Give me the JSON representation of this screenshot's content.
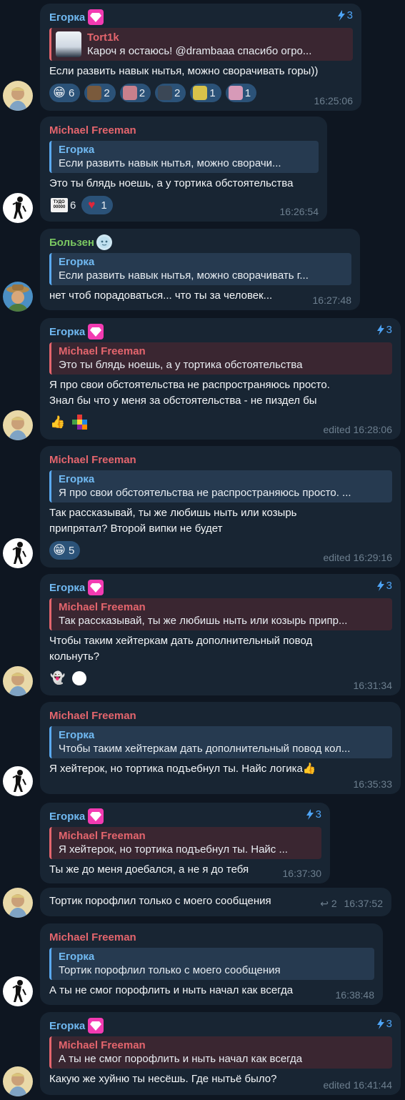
{
  "messages": [
    {
      "sender": "Егорка",
      "boost": "3",
      "reply": {
        "name": "Tort1k",
        "text": "Кароч я остаюсь! @drambaaa спасибо огро..."
      },
      "text": "Если развить навык нытья, можно сворачивать горы))",
      "reactions": [
        {
          "icon": "grinning-emoji",
          "count": "6"
        },
        {
          "icon": "user-avatar-1",
          "count": "2"
        },
        {
          "icon": "user-avatar-2",
          "count": "2"
        },
        {
          "icon": "user-avatar-3",
          "count": "2"
        },
        {
          "icon": "user-avatar-4",
          "count": "1"
        },
        {
          "icon": "user-avatar-5",
          "count": "1"
        }
      ],
      "time": "16:25:06"
    },
    {
      "sender": "Michael Freeman",
      "reply": {
        "name": "Егорка",
        "text": "Если развить навык нытья, можно сворачи..."
      },
      "text": "Это ты блядь ноешь, а у тортика обстоятельства",
      "reactions": [
        {
          "icon": "tudo-sign-emoji",
          "label": "ТУДО 00000",
          "count": "6"
        },
        {
          "icon": "heart-emoji",
          "count": "1"
        }
      ],
      "time": "16:26:54"
    },
    {
      "sender": "Бользен",
      "reply": {
        "name": "Егорка",
        "text": "Если развить навык нытья, можно сворачивать г..."
      },
      "text": "нет чтоб порадоваться... что ты за человек...",
      "time": "16:27:48"
    },
    {
      "sender": "Егорка",
      "boost": "3",
      "reply": {
        "name": "Michael Freeman",
        "text": "Это ты блядь ноешь, а у тортика обстоятельства"
      },
      "text1": "Я про свои обстоятельства не распространяюсь просто.",
      "text2": "Знал бы что у меня за обстоятельства - не пиздел бы",
      "time": "edited 16:28:06"
    },
    {
      "sender": "Michael Freeman",
      "reply": {
        "name": "Егорка",
        "text": "Я про свои обстоятельства не распространяюсь просто. ..."
      },
      "text1": "Так рассказывай, ты же любишь ныть или козырь",
      "text2": "припрятал? Второй випки не будет",
      "reactions": [
        {
          "icon": "grinning-emoji",
          "count": "5"
        }
      ],
      "time": "edited 16:29:16"
    },
    {
      "sender": "Егорка",
      "boost": "3",
      "reply": {
        "name": "Michael Freeman",
        "text": "Так рассказывай, ты же любишь ныть или козырь припр..."
      },
      "text1": "Чтобы таким хейтеркам дать дополнительный повод",
      "text2": "кольнуть?",
      "time": "16:31:34"
    },
    {
      "sender": "Michael Freeman",
      "reply": {
        "name": "Егорка",
        "text": "Чтобы таким хейтеркам дать дополнительный повод кол..."
      },
      "text": "Я хейтерок, но тортика подъебнул ты. Найс логика",
      "time": "16:35:33"
    },
    {
      "sender": "Егорка",
      "boost": "3",
      "reply": {
        "name": "Michael Freeman",
        "text": "Я хейтерок, но тортика подъебнул ты. Найс ..."
      },
      "text": "Ты же до меня доебался, а не я до тебя",
      "time": "16:37:30"
    },
    {
      "text": "Тортик порофлил только с моего сообщения",
      "replies": "2",
      "time": "16:37:52"
    },
    {
      "sender": "Michael Freeman",
      "reply": {
        "name": "Егорка",
        "text": "Тортик порофлил только с моего сообщения"
      },
      "text": "А ты не смог порофлить и ныть начал как всегда",
      "time": "16:38:48"
    },
    {
      "sender": "Егорка",
      "boost": "3",
      "reply": {
        "name": "Michael Freeman",
        "text": "А ты не смог порофлить и ныть начал как всегда"
      },
      "text": "Какую же хуйню ты несёшь. Где нытьё было?",
      "time": "edited 16:41:44"
    }
  ],
  "colors": {
    "background": "#0e1621",
    "bubble": "#182533",
    "egorka": "#71baf3",
    "michael": "#e4656d",
    "bolzen": "#7bc862",
    "reaction_pill": "#2b5278",
    "meta": "#6d7f8f"
  }
}
